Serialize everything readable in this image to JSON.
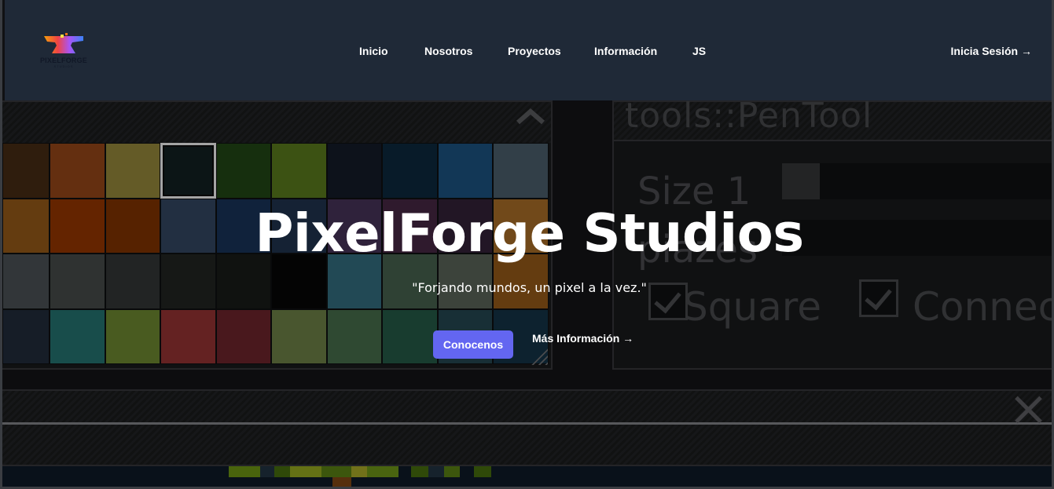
{
  "nav": {
    "brand": "PIXELFORGE",
    "brand_sub": "STUDIOS",
    "items": [
      {
        "label": "Inicio"
      },
      {
        "label": "Nosotros"
      },
      {
        "label": "Proyectos"
      },
      {
        "label": "Información"
      },
      {
        "label": "JS"
      }
    ],
    "login_label": "Inicia Sesión →"
  },
  "hero": {
    "title": "PixelForge Studios",
    "subtitle": "\"Forjando mundos, un pixel a la vez.\"",
    "primary_button": "Conocenos",
    "secondary_link": "Más Información →"
  },
  "background": {
    "tool_title": "tools::PenTool",
    "size_label": "Size 1",
    "row2_label": "piazes",
    "checkbox_square": "Square",
    "checkbox_connect": "Connec",
    "palette_colors": [
      "#3a2410",
      "#7a3a14",
      "#7a7030",
      "#0f1a1c",
      "#1c3a12",
      "#4a6418",
      "#101722",
      "#0a2232",
      "#17446a",
      "#3e4e58",
      "#7a4a14",
      "#7a2c00",
      "#6a2a00",
      "#2a3a50",
      "#142a48",
      "#1a2a40",
      "#3a2a48",
      "#3a2038",
      "#2a1c2e",
      "#8a5a20",
      "#3e4246",
      "#3a3e3c",
      "#2a2c2c",
      "#1c1e1c",
      "#141614",
      "#050505",
      "#2a5a68",
      "#3a5040",
      "#4a5248",
      "#7a4a14",
      "#1c2430",
      "#1e5e5c",
      "#5a7028",
      "#7a2a2a",
      "#5a1e24",
      "#5a6a3a",
      "#3a5a3e",
      "#1e4a3a",
      "#1e3a42",
      "#102a3a"
    ],
    "selected_swatch_index": 3,
    "accent": "#6366f1",
    "nav_bg": "#1f2937"
  }
}
